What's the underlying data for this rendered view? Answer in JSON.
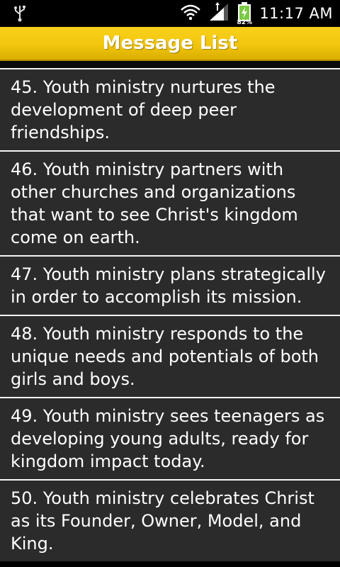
{
  "status_bar": {
    "left_icon": "usb-icon",
    "wifi_icon": "wifi-icon",
    "signal_icon": "signal-icon",
    "battery_icon": "battery-charging-icon",
    "battery_percent": "82%",
    "time": "11:17 AM"
  },
  "header": {
    "title": "Message List",
    "background_color": "#f2c60d"
  },
  "messages": [
    {
      "text": "45. Youth ministry nurtures the development of deep peer friendships."
    },
    {
      "text": "46. Youth ministry partners with other churches and organizations that want to see Christ's kingdom come on earth."
    },
    {
      "text": "47. Youth ministry plans strategically in order to accomplish its mission."
    },
    {
      "text": "48. Youth ministry responds to the unique needs and potentials of both girls and boys."
    },
    {
      "text": "49. Youth ministry sees teenagers as developing young adults, ready for kingdom impact today."
    },
    {
      "text": "50. Youth ministry celebrates Christ as its Founder, Owner, Model, and King."
    }
  ]
}
